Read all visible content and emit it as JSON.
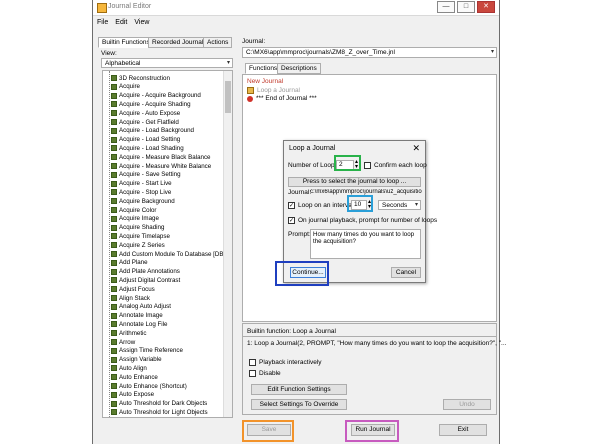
{
  "window": {
    "title": "Journal Editor",
    "controls": [
      "—",
      "□",
      "✕"
    ]
  },
  "menu": [
    "File",
    "Edit",
    "View"
  ],
  "left_tabs": [
    "Builtin Functions",
    "Recorded Journals",
    "Actions"
  ],
  "view_label": "View:",
  "view_value": "Alphabetical",
  "functions": [
    "3D Reconstruction",
    "Acquire",
    "Acquire - Acquire Background",
    "Acquire - Acquire Shading",
    "Acquire - Auto Expose",
    "Acquire - Get Flatfield",
    "Acquire - Load Background",
    "Acquire - Load Setting",
    "Acquire - Load Shading",
    "Acquire - Measure Black Balance",
    "Acquire - Measure White Balance",
    "Acquire - Save Setting",
    "Acquire - Start Live",
    "Acquire - Stop Live",
    "Acquire Background",
    "Acquire Color",
    "Acquire Image",
    "Acquire Shading",
    "Acquire Timelapse",
    "Acquire Z Series",
    "Add Custom Module To Database [DB",
    "Add Plane",
    "Add Plate Annotations",
    "Adjust Digital Contrast",
    "Adjust Focus",
    "Align Stack",
    "Analog Auto Adjust",
    "Annotate Image",
    "Annotate Log File",
    "Arithmetic",
    "Arrow",
    "Assign Time Reference",
    "Assign Variable",
    "Auto Align",
    "Auto Enhance",
    "Auto Enhance (Shortcut)",
    "Auto Expose",
    "Auto Threshold for Dark Objects",
    "Auto Threshold for Light Objects"
  ],
  "journal_label": "Journal:",
  "journal_path": "C:\\MX6\\app\\mmproc\\journals\\ZM8_Z_over_Time.jnl",
  "right_tabs": [
    "Functions",
    "Descriptions"
  ],
  "journal_items": [
    "New Journal",
    "Loop a Journal",
    "*** End of Journal ***"
  ],
  "builtin_function": "Builtin function: Loop a Journal",
  "builtin_call": "1: Loop a Journal(2, PROMPT, \"How many times do you want to loop the acquisition?\", \"...",
  "options": {
    "playback": "Playback interactively",
    "disable": "Disable"
  },
  "buttons": {
    "edit_settings": "Edit Function Settings",
    "select_override": "Select Settings To Override",
    "undo": "Undo",
    "save": "Save",
    "run": "Run Journal",
    "exit": "Exit"
  },
  "dialog": {
    "title": "Loop a Journal",
    "close": "✕",
    "number_of_loop_label": "Number of Loop",
    "number_of_loop_value": "2",
    "confirm_each_loop": "Confirm each loop",
    "press_select": "Press to select the journal to loop ...",
    "journal_label": "Journal:",
    "journal_value": "c:\\mx6\\app\\mmproc\\journals\\uz_acquisitio",
    "loop_interval_label": "Loop on an interva",
    "interval_value": "10",
    "interval_unit": "Seconds",
    "prompt_check": "On journal playback, prompt for number of loops",
    "prompt_label": "Prompt:",
    "prompt_text": "How many times do you want to loop the acquisition?",
    "continue": "Continue...",
    "cancel": "Cancel"
  },
  "highlight_colors": {
    "number_of_loop": "#29b24a",
    "interval": "#2a9fd8",
    "continue": "#1f3fbf",
    "save": "#f2932b",
    "run": "#c75bbf"
  }
}
